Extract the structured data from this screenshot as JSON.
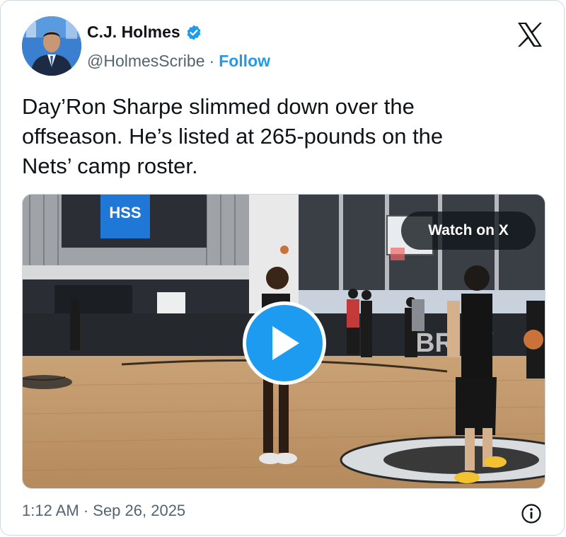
{
  "author": {
    "name": "C.J. Holmes",
    "handle": "@HolmesScribe",
    "separator": "·",
    "follow_label": "Follow",
    "verified_icon": "verified-badge-icon",
    "verified_color": "#1d9bf0"
  },
  "platform": {
    "logo_icon": "x-logo-icon"
  },
  "tweet": {
    "text": "Day’Ron Sharpe slimmed down over the\noffseason. He’s listed at 265-pounds on the\nNets’ camp roster."
  },
  "media": {
    "watch_label": "Watch on X",
    "play_icon": "play-icon",
    "sign_text": "HSS",
    "wall_text": "BR     LY"
  },
  "footer": {
    "timestamp": "1:12 AM · Sep 26, 2025",
    "info_icon": "info-icon"
  },
  "colors": {
    "accent": "#1d9bf0",
    "text": "#0f1419",
    "secondary": "#536471",
    "border": "#cfd9de"
  }
}
